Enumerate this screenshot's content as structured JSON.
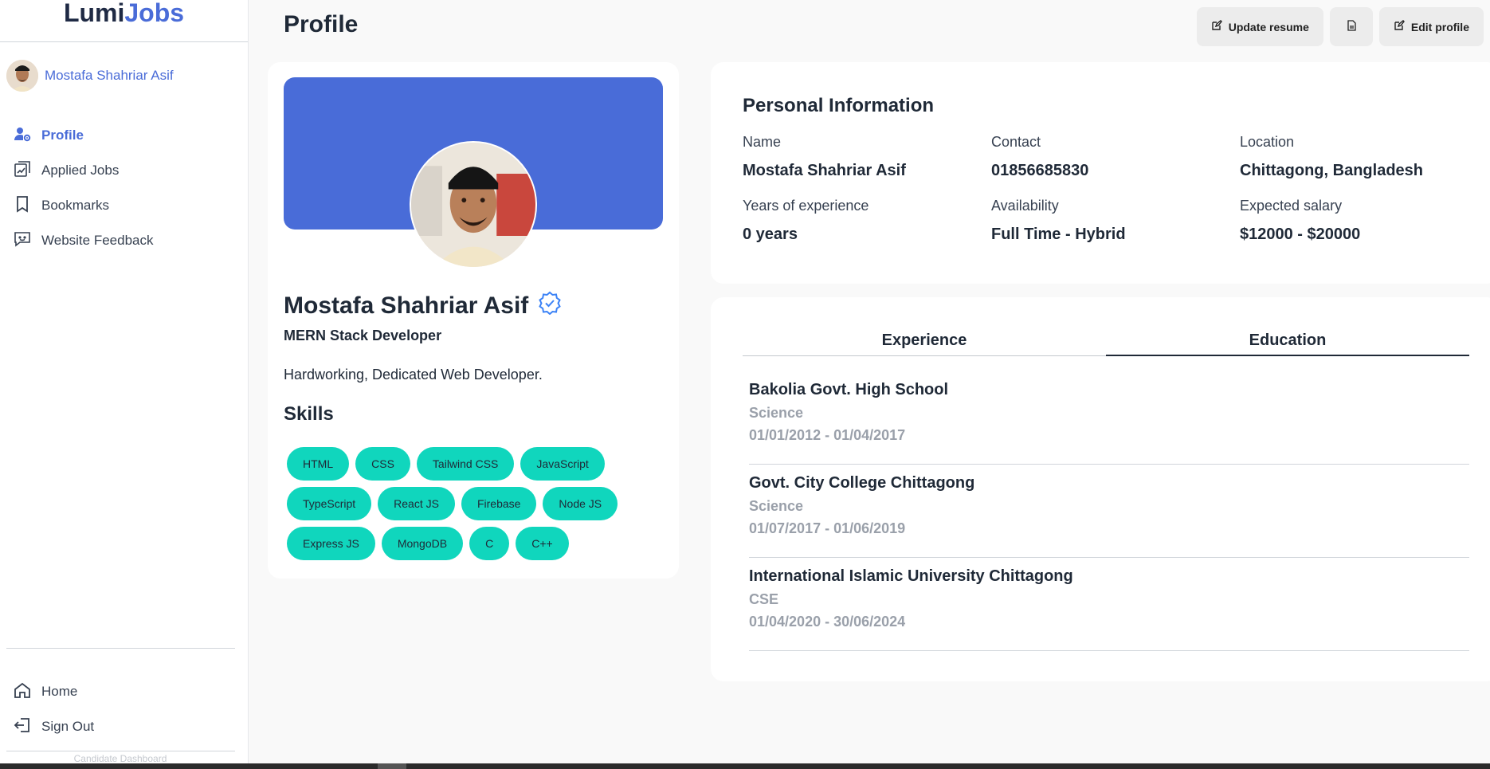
{
  "brand": {
    "part1": "Lumi",
    "part2": "Jobs"
  },
  "user": {
    "name": "Mostafa Shahriar Asif"
  },
  "sidebar": {
    "items": [
      {
        "label": "Profile",
        "icon": "user-gear-icon",
        "active": true
      },
      {
        "label": "Applied Jobs",
        "icon": "applied-jobs-icon",
        "active": false
      },
      {
        "label": "Bookmarks",
        "icon": "bookmark-icon",
        "active": false
      },
      {
        "label": "Website Feedback",
        "icon": "feedback-icon",
        "active": false
      }
    ],
    "bottom_items": [
      {
        "label": "Home",
        "icon": "home-icon"
      },
      {
        "label": "Sign Out",
        "icon": "sign-out-icon"
      }
    ],
    "footnote": "Candidate Dashboard"
  },
  "header": {
    "title": "Profile",
    "update_resume_label": "Update resume",
    "edit_profile_label": "Edit profile"
  },
  "profile": {
    "name": "Mostafa Shahriar Asif",
    "role": "MERN Stack Developer",
    "bio": "Hardworking, Dedicated Web Developer.",
    "skills_title": "Skills",
    "skills": [
      "HTML",
      "CSS",
      "Tailwind CSS",
      "JavaScript",
      "TypeScript",
      "React JS",
      "Firebase",
      "Node JS",
      "Express JS",
      "MongoDB",
      "C",
      "C++"
    ]
  },
  "personal_info": {
    "title": "Personal Information",
    "fields": [
      {
        "label": "Name",
        "value": "Mostafa Shahriar Asif"
      },
      {
        "label": "Contact",
        "value": "01856685830"
      },
      {
        "label": "Location",
        "value": "Chittagong, Bangladesh"
      },
      {
        "label": "Years of experience",
        "value": "0 years"
      },
      {
        "label": "Availability",
        "value": "Full Time - Hybrid"
      },
      {
        "label": "Expected salary",
        "value": "$12000 - $20000"
      }
    ]
  },
  "tabs": {
    "experience": "Experience",
    "education": "Education",
    "active": "Education"
  },
  "education": [
    {
      "institution": "Bakolia Govt. High School",
      "field": "Science",
      "dates": "01/01/2012 - 01/04/2017"
    },
    {
      "institution": "Govt. City College Chittagong",
      "field": "Science",
      "dates": "01/07/2017 - 01/06/2019"
    },
    {
      "institution": "International Islamic University Chittagong",
      "field": "CSE",
      "dates": "01/04/2020 - 30/06/2024"
    }
  ],
  "colors": {
    "accent": "#4a6cd8",
    "skill_bg": "#10d6bd",
    "banner": "#496cd8"
  }
}
